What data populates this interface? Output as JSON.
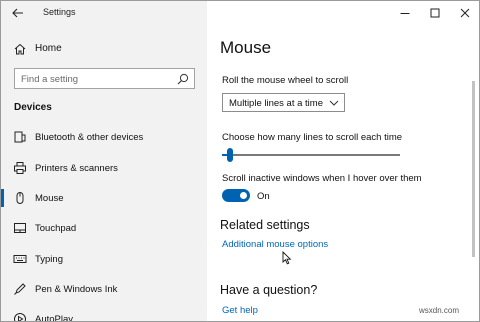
{
  "window": {
    "title": "Settings",
    "controls": [
      "minimize-icon",
      "maximize-icon",
      "close-icon"
    ]
  },
  "sidebar": {
    "home_label": "Home",
    "search_placeholder": "Find a setting",
    "section_title": "Devices",
    "items": [
      {
        "label": "Bluetooth & other devices",
        "icon": "bluetooth-icon",
        "selected": false
      },
      {
        "label": "Printers & scanners",
        "icon": "printer-icon",
        "selected": false
      },
      {
        "label": "Mouse",
        "icon": "mouse-icon",
        "selected": true
      },
      {
        "label": "Touchpad",
        "icon": "touchpad-icon",
        "selected": false
      },
      {
        "label": "Typing",
        "icon": "keyboard-icon",
        "selected": false
      },
      {
        "label": "Pen & Windows Ink",
        "icon": "pen-icon",
        "selected": false
      },
      {
        "label": "AutoPlay",
        "icon": "autoplay-icon",
        "selected": false
      }
    ]
  },
  "main": {
    "title": "Mouse",
    "scroll_label": "Roll the mouse wheel to scroll",
    "scroll_value": "Multiple lines at a time",
    "lines_label": "Choose how many lines to scroll each time",
    "lines_slider_fraction": 0.03,
    "inactive_label": "Scroll inactive windows when I hover over them",
    "inactive_state": "On",
    "related_heading": "Related settings",
    "related_link": "Additional mouse options",
    "question_heading": "Have a question?",
    "help_link": "Get help"
  },
  "colors": {
    "accent": "#0063b1",
    "link": "#0067b8",
    "sidebar_bg": "#f2f2f2"
  },
  "watermark": "wsxdn.com"
}
